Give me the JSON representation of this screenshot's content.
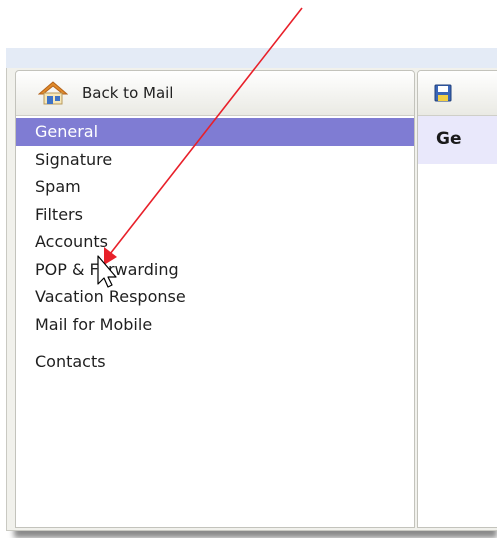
{
  "sidebar": {
    "back_label": "Back to Mail",
    "items": [
      {
        "label": "General",
        "selected": true
      },
      {
        "label": "Signature"
      },
      {
        "label": "Spam"
      },
      {
        "label": "Filters"
      },
      {
        "label": "Accounts"
      },
      {
        "label": "POP & Forwarding"
      },
      {
        "label": "Vacation Response"
      },
      {
        "label": "Mail for Mobile"
      }
    ],
    "contacts_label": "Contacts"
  },
  "main": {
    "heading": "Ge"
  },
  "icons": {
    "home": "home-icon",
    "save": "save-icon",
    "cursor": "mouse-cursor-icon"
  },
  "colors": {
    "selected_bg": "#7f7cd3",
    "heading_bg": "#e9e8fb",
    "arrow": "#e8202a"
  }
}
